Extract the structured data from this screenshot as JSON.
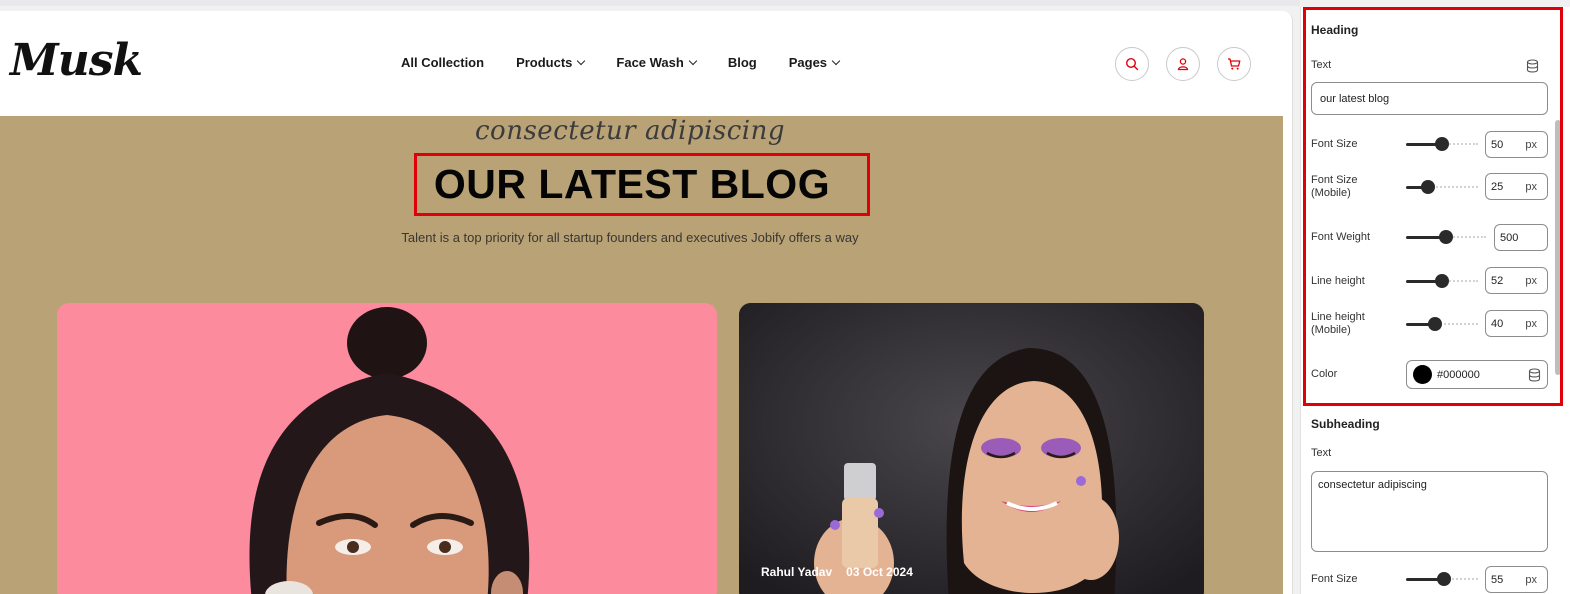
{
  "preview": {
    "logo": "Musk",
    "nav": [
      {
        "label": "All Collection",
        "has_dropdown": false
      },
      {
        "label": "Products",
        "has_dropdown": true
      },
      {
        "label": "Face Wash",
        "has_dropdown": true
      },
      {
        "label": "Blog",
        "has_dropdown": false
      },
      {
        "label": "Pages",
        "has_dropdown": true
      }
    ],
    "icons": [
      "search-icon",
      "user-icon",
      "cart-icon"
    ],
    "accent_color": "#e0000a",
    "section_bg": "#b8a276",
    "subheading": "consectetur adipiscing",
    "heading": "OUR LATEST BLOG",
    "description": "Talent is a top priority for all startup founders and executives Jobify offers a way",
    "cards": [
      {
        "bg": "#fb8b9d"
      },
      {
        "bg": "#2c2a2e",
        "author": "Rahul Yadav",
        "date": "03 Oct 2024"
      }
    ]
  },
  "settings": {
    "heading_section": {
      "title": "Heading",
      "text_label": "Text",
      "text_value": "our latest blog",
      "font_size": {
        "label": "Font Size",
        "value": "50",
        "unit": "px",
        "level": 0.5
      },
      "font_size_mobile": {
        "label": "Font Size (Mobile)",
        "value": "25",
        "unit": "px",
        "level": 0.3
      },
      "font_weight": {
        "label": "Font Weight",
        "value": "500",
        "level": 0.5
      },
      "line_height": {
        "label": "Line height",
        "value": "52",
        "unit": "px",
        "level": 0.5
      },
      "line_height_mobile": {
        "label": "Line height (Mobile)",
        "value": "40",
        "unit": "px",
        "level": 0.4
      },
      "color": {
        "label": "Color",
        "value": "#000000"
      }
    },
    "subheading_section": {
      "title": "Subheading",
      "text_label": "Text",
      "text_value": "consectetur adipiscing",
      "font_size": {
        "label": "Font Size",
        "value": "55",
        "unit": "px",
        "level": 0.53
      }
    }
  }
}
